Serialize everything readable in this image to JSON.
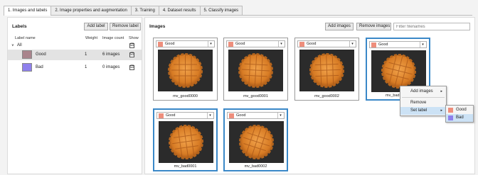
{
  "tabs": [
    {
      "label": "1. Images and labels",
      "active": true
    },
    {
      "label": "2. Image properties and augmentation",
      "active": false
    },
    {
      "label": "3. Training",
      "active": false
    },
    {
      "label": "4. Dataset results",
      "active": false
    },
    {
      "label": "5. Classify images",
      "active": false
    }
  ],
  "labels_panel": {
    "title": "Labels",
    "add_label": "Add label",
    "remove_label": "Remove label",
    "columns": {
      "name": "Label name",
      "weight": "Weight",
      "count": "Image count",
      "show": "Show"
    },
    "root": {
      "label": "All",
      "expand_glyph": "∨"
    },
    "rows": [
      {
        "name": "Good",
        "weight": "1",
        "count": "6 images",
        "color": "#a9848c",
        "show": true
      },
      {
        "name": "Bad",
        "weight": "1",
        "count": "0 images",
        "color": "#8e80ec",
        "show": true
      }
    ]
  },
  "images_panel": {
    "title": "Images",
    "add_images": "Add images",
    "remove_images": "Remove images",
    "filter_placeholder": "Filter filenames",
    "cards": [
      {
        "label": "Good",
        "filename": "mv_good0000"
      },
      {
        "label": "Good",
        "filename": "mv_good0001"
      },
      {
        "label": "Good",
        "filename": "mv_good0002"
      },
      {
        "label": "Good",
        "filename": "mv_bad0000"
      },
      {
        "label": "Good",
        "filename": "mv_bad0001"
      },
      {
        "label": "Good",
        "filename": "mv_bad0002"
      }
    ],
    "partial_filename": "mv_bad"
  },
  "context_menu": {
    "items": [
      {
        "label": "Add images",
        "arrow": "▸"
      },
      {
        "label": "Remove"
      },
      {
        "label": "Set label",
        "arrow": "▸"
      }
    ],
    "submenu": [
      {
        "label": "Good",
        "color": "#ee8e7c"
      },
      {
        "label": "Bad",
        "color": "#8e80ec"
      }
    ]
  },
  "colors": {
    "accent_blue": "#3a88c8",
    "label_swatch": "#ee8e7c"
  },
  "icons": {
    "dropdown": "▾",
    "checkbox": "☑"
  }
}
